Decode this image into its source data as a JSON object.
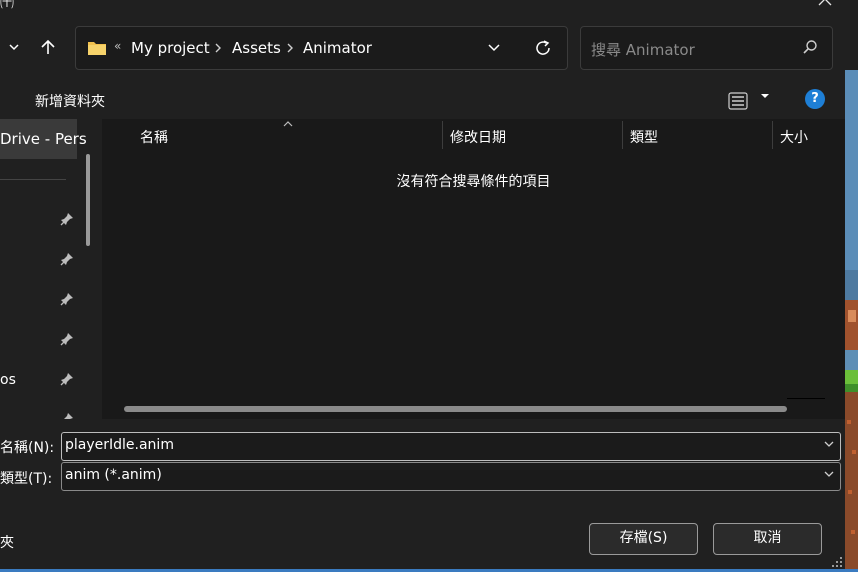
{
  "window": {
    "title_glyph": "㈩"
  },
  "nav": {
    "breadcrumb_overflow": "«",
    "breadcrumbs": [
      {
        "label": "My project"
      },
      {
        "label": "Assets"
      },
      {
        "label": "Animator"
      }
    ]
  },
  "search": {
    "placeholder": "搜尋 Animator"
  },
  "toolbar": {
    "new_folder": "新增資料夾",
    "help": "?"
  },
  "sidebar": {
    "selected": "Drive - Pers",
    "items": [
      {
        "label": "",
        "pinned": true
      },
      {
        "label": "",
        "pinned": true
      },
      {
        "label": "",
        "pinned": true
      },
      {
        "label": "",
        "pinned": true
      },
      {
        "label": "os",
        "pinned": true
      }
    ]
  },
  "file_list": {
    "columns": [
      {
        "label": "名稱"
      },
      {
        "label": "修改日期"
      },
      {
        "label": "類型"
      },
      {
        "label": "大小"
      }
    ],
    "empty_message": "沒有符合搜尋條件的項目"
  },
  "save_form": {
    "name_label": "名稱(N):",
    "name_value": "playerIdle.anim",
    "type_label": "類型(T):",
    "type_value": "anim (*.anim)",
    "hide_folders": "夾",
    "save_button": "存檔(S)",
    "cancel_button": "取消"
  },
  "colors": {
    "background": "#202020",
    "accent": "#1e7fd6",
    "folder": "#f2c14e"
  }
}
